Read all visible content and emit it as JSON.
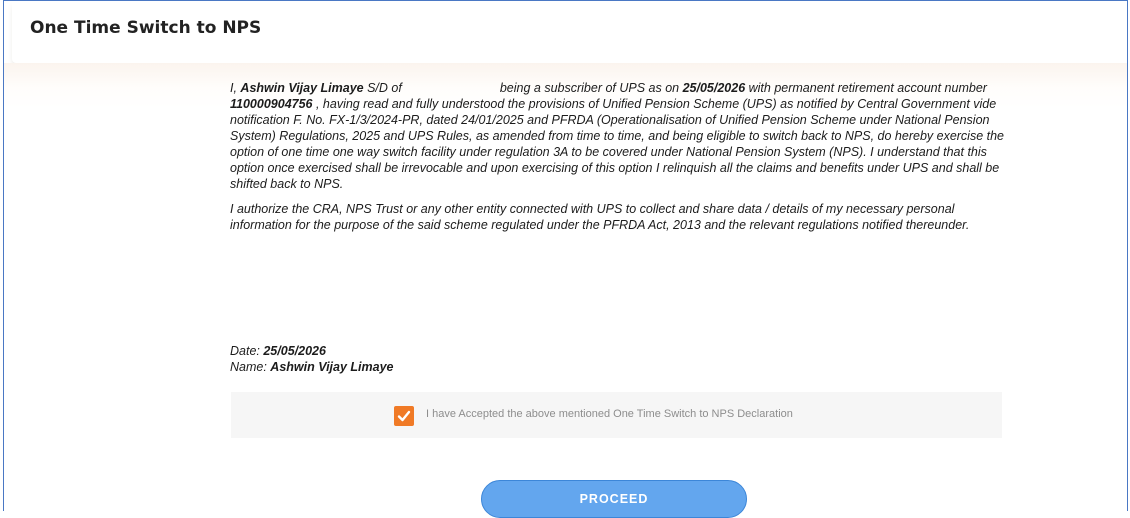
{
  "page": {
    "title": "One Time Switch to NPS"
  },
  "declaration": {
    "p1": {
      "intro": "I, ",
      "subscriber_name": "Ashwin Vijay Limaye",
      "relation_label": " S/D of",
      "mid": "being a subscriber of UPS as on ",
      "as_on_date": "25/05/2026",
      "after_date": " with permanent retirement account number ",
      "pran": "110000904756",
      "body": " , having read and fully understood the provisions of Unified Pension Scheme (UPS) as notified by Central Government vide notification F. No. FX-1/3/2024-PR, dated 24/01/2025 and PFRDA (Operationalisation of Unified Pension Scheme under National Pension System) Regulations, 2025 and UPS Rules, as amended from time to time, and being eligible to switch back to NPS, do hereby exercise the option of one time one way switch facility under regulation 3A to be covered under National Pension System (NPS). I understand that this option once exercised shall be irrevocable and upon exercising of this option I relinquish all the claims and benefits under UPS and shall be shifted back to NPS."
    },
    "p2": "I authorize the CRA, NPS Trust or any other entity connected with UPS to collect and share data / details of my necessary personal information for the purpose of the said scheme regulated under the PFRDA Act, 2013 and the relevant regulations notified thereunder."
  },
  "signature": {
    "date_label": "Date: ",
    "date_value": "25/05/2026",
    "name_label": "Name: ",
    "name_value": "Ashwin Vijay Limaye"
  },
  "acceptance": {
    "checked": true,
    "label": "I have Accepted the above mentioned One Time Switch to NPS Declaration",
    "checkbox_color": "#f07a26"
  },
  "actions": {
    "proceed_label": "PROCEED",
    "proceed_color": "#63a6ee"
  }
}
